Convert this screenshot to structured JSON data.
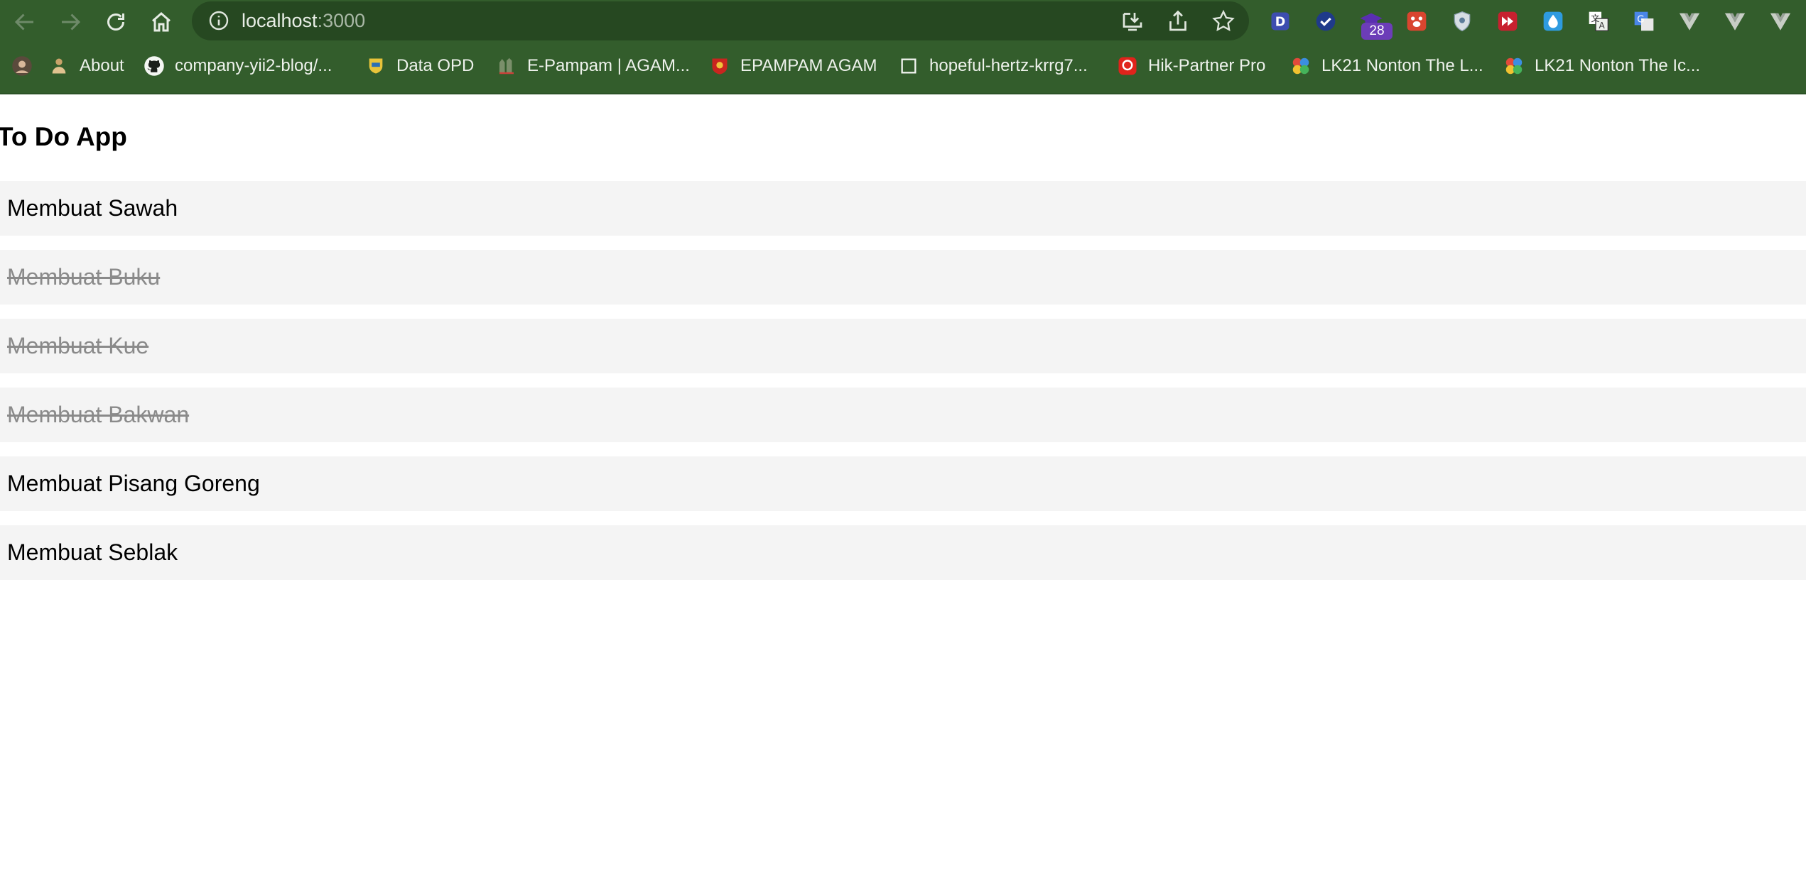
{
  "browser": {
    "url_host": "localhost",
    "url_port": ":3000",
    "extension_badge_count": "28",
    "bookmarks": [
      {
        "label": "About",
        "icon": "person-avatar-icon"
      },
      {
        "label": "company-yii2-blog/...",
        "icon": "github-icon"
      },
      {
        "label": "Data OPD",
        "icon": "crest-icon"
      },
      {
        "label": "E-Pampam | AGAM...",
        "icon": "building-icon"
      },
      {
        "label": "EPAMPAM AGAM",
        "icon": "shield-emblem-icon"
      },
      {
        "label": "hopeful-hertz-krrg7...",
        "icon": "blank-page-icon"
      },
      {
        "label": "Hik-Partner Pro",
        "icon": "hik-icon"
      },
      {
        "label": "LK21 Nonton The L...",
        "icon": "film-reel-icon"
      },
      {
        "label": "LK21 Nonton The Ic...",
        "icon": "film-reel-icon"
      }
    ]
  },
  "app": {
    "title": "To Do App",
    "todos": [
      {
        "text": "Membuat Sawah",
        "completed": false
      },
      {
        "text": "Membuat Buku",
        "completed": true
      },
      {
        "text": "Membuat Kue",
        "completed": true
      },
      {
        "text": "Membuat Bakwan",
        "completed": true
      },
      {
        "text": "Membuat Pisang Goreng",
        "completed": false
      },
      {
        "text": "Membuat Seblak",
        "completed": false
      }
    ]
  },
  "colors": {
    "chrome_green": "#335d2c",
    "omnibox_green": "#264821",
    "item_background": "#f4f4f4",
    "completed_text": "#8a8a8a"
  }
}
